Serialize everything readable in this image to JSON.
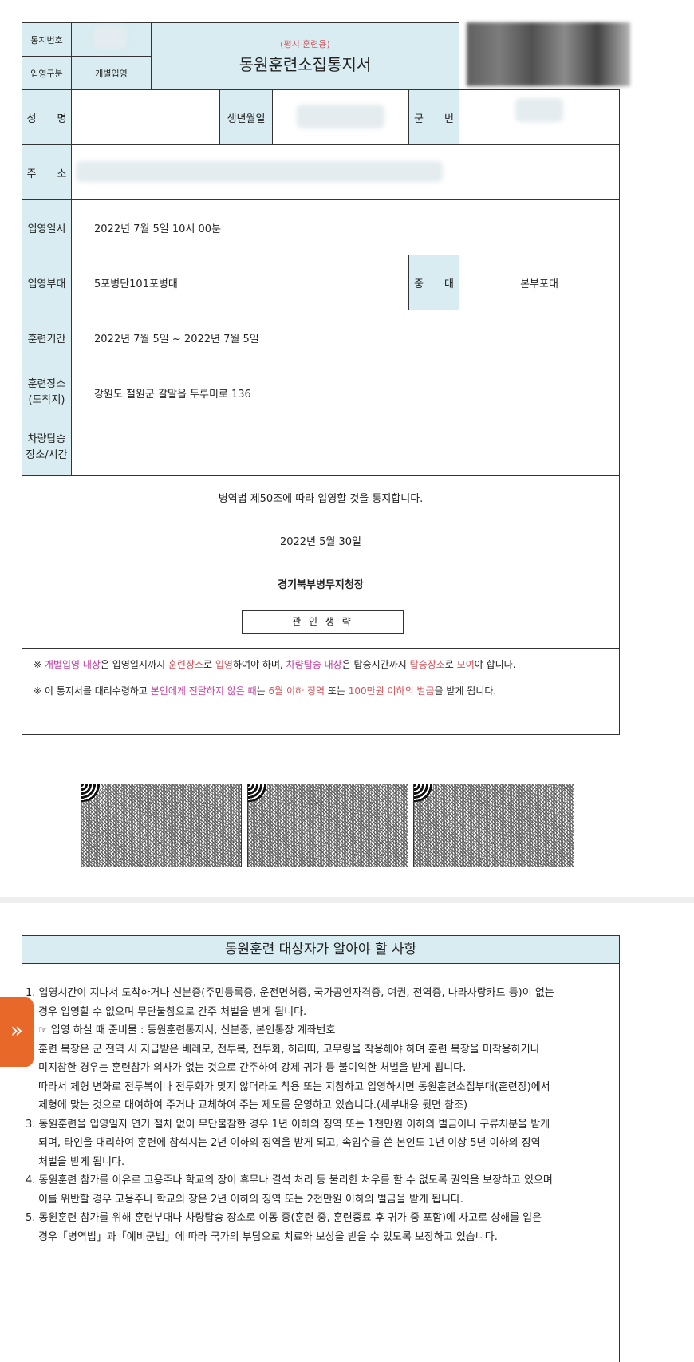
{
  "header": {
    "notice_no_label": "통지번호",
    "entry_type_label": "입영구분",
    "entry_type_value": "개별입영",
    "subtitle": "(평시 훈련용)",
    "title": "동원훈련소집통지서"
  },
  "fields": {
    "name_label": "성　　명",
    "birth_label": "생년월일",
    "service_no_label": "군　　번",
    "address_label": "주　　소",
    "entry_datetime_label": "입영일시",
    "entry_datetime_value": "2022년 7월 5일 10시 00분",
    "unit_label": "입영부대",
    "unit_value": "5포병단101포병대",
    "company_label": "중　　대",
    "company_value": "본부포대",
    "period_label": "훈련기간",
    "period_value": "2022년 7월 5일 ~ 2022년 7월 5일",
    "place_label": "훈련장소\n(도착지)",
    "place_value": "강원도 철원군 갈말읍 두루미로 136",
    "vehicle_label": "차량탑승\n장소/시간",
    "vehicle_value": ""
  },
  "notice": {
    "text": "병역법 제50조에 따라 입영할 것을 통지합니다.",
    "date": "2022년 5월 30일",
    "issuer": "경기북부병무지청장",
    "seal_label": "관 인 생 략"
  },
  "notes": {
    "n1": [
      "※ ",
      "개별입영 대상",
      "은 입영일시까지 ",
      "훈련장소",
      "로 ",
      "입영",
      "하여야 하며, ",
      "차량탑승 대상",
      "은 탑승시간까지 ",
      "탑승장소",
      "로 ",
      "모여",
      "야 합니다."
    ],
    "n2": [
      "※ 이 통지서를 대리수령하고 ",
      "본인에게 전달하지 않은 때",
      "는 ",
      "6월 이하 징역",
      " 또는 ",
      "100만원 이하의 벌금",
      "을 받게 됩니다."
    ]
  },
  "section2": {
    "title": "동원훈련 대상자가 알아야 할 사항",
    "lines": [
      "1. 입영시간이 지나서 도착하거나 신분증(주민등록증, 운전면허증, 국가공인자격증, 여권, 전역증, 나라사랑카드 등)이 없는",
      "경우 입영할 수 없으며 무단불참으로 간주 처벌을 받게 됩니다.",
      "☞ 입영 하실 때 준비물 : 동원훈련통지서, 신분증, 본인통장 계좌번호",
      "훈련 복장은 군 전역 시 지급받은 베레모, 전투복, 전투화, 허리띠, 고무링을 착용해야 하며 훈련 복장을 미착용하거나",
      "미지참한 경우는 훈련참가 의사가 없는 것으로 간주하여 강제 귀가 등 불이익한 처벌을 받게 됩니다.",
      "따라서 체형 변화로 전투복이나 전투화가 맞지 않더라도 착용 또는 지참하고 입영하시면 동원훈련소집부대(훈련장)에서",
      "체형에 맞는 것으로 대여하여 주거나 교체하여 주는 제도를 운영하고 있습니다.(세부내용 뒷면 참조)",
      "3. 동원훈련을 입영일자 연기 절차 없이 무단불참한 경우 1년 이하의 징역 또는 1천만원 이하의 벌금이나 구류처분을 받게",
      "되며,  타인을 대리하여 훈련에 참석시는 2년 이하의 징역을 받게 되고, 속임수를 쓴 본인도 1년 이상 5년 이하의 징역",
      "처벌을 받게 됩니다.",
      "4. 동원훈련 참가를 이유로 고용주나 학교의 장이 휴무나 결석 처리 등 불리한 처우를 할 수 없도록 권익을 보장하고 있으며",
      "이를 위반할 경우 고용주나 학교의 장은 2년 이하의 징역 또는 2천만원 이하의 벌금을 받게 됩니다.",
      "5. 동원훈련 참가를 위해 훈련부대나 차량탑승 장소로 이동 중(훈련 중, 훈련종료 후 귀가 중 포함)에 사고로 상해를  입은",
      "경우「병역법」과「예비군법」에 따라 국가의 부담으로 치료와 보상을 받을 수 있도록 보장하고 있습니다."
    ]
  },
  "side_button": {
    "icon": "double-chevron-right-icon",
    "color": "#e8682a"
  },
  "colors": {
    "label_bg": "#d8ecf1",
    "highlight_red": "#d0545a",
    "highlight_pink": "#c03da0"
  }
}
